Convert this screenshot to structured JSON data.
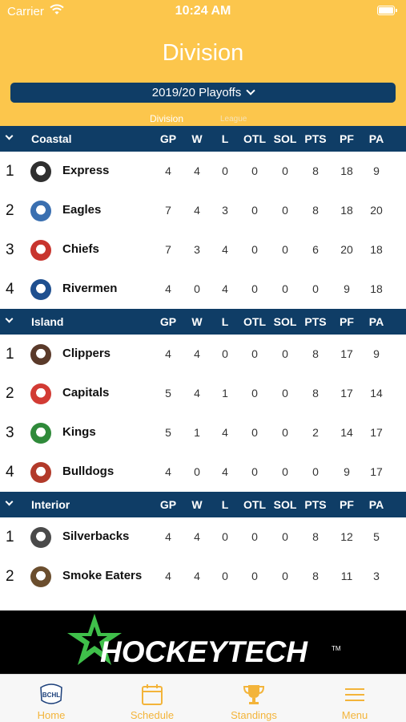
{
  "status": {
    "carrier": "Carrier",
    "time": "10:24 AM"
  },
  "header": {
    "title": "Division",
    "season": "2019/20 Playoffs",
    "tabs": {
      "division": "Division",
      "league": "League"
    }
  },
  "columns": [
    "GP",
    "W",
    "L",
    "OTL",
    "SOL",
    "PTS",
    "PF",
    "PA"
  ],
  "groups": [
    {
      "name": "Coastal",
      "teams": [
        {
          "rank": "1",
          "name": "Express",
          "stats": [
            "4",
            "4",
            "0",
            "0",
            "0",
            "8",
            "18",
            "9"
          ]
        },
        {
          "rank": "2",
          "name": "Eagles",
          "stats": [
            "7",
            "4",
            "3",
            "0",
            "0",
            "8",
            "18",
            "20"
          ]
        },
        {
          "rank": "3",
          "name": "Chiefs",
          "stats": [
            "7",
            "3",
            "4",
            "0",
            "0",
            "6",
            "20",
            "18"
          ]
        },
        {
          "rank": "4",
          "name": "Rivermen",
          "stats": [
            "4",
            "0",
            "4",
            "0",
            "0",
            "0",
            "9",
            "18"
          ]
        }
      ]
    },
    {
      "name": "Island",
      "teams": [
        {
          "rank": "1",
          "name": "Clippers",
          "stats": [
            "4",
            "4",
            "0",
            "0",
            "0",
            "8",
            "17",
            "9"
          ]
        },
        {
          "rank": "2",
          "name": "Capitals",
          "stats": [
            "5",
            "4",
            "1",
            "0",
            "0",
            "8",
            "17",
            "14"
          ]
        },
        {
          "rank": "3",
          "name": "Kings",
          "stats": [
            "5",
            "1",
            "4",
            "0",
            "0",
            "2",
            "14",
            "17"
          ]
        },
        {
          "rank": "4",
          "name": "Bulldogs",
          "stats": [
            "4",
            "0",
            "4",
            "0",
            "0",
            "0",
            "9",
            "17"
          ]
        }
      ]
    },
    {
      "name": "Interior",
      "teams": [
        {
          "rank": "1",
          "name": "Silverbacks",
          "stats": [
            "4",
            "4",
            "0",
            "0",
            "0",
            "8",
            "12",
            "5"
          ]
        },
        {
          "rank": "2",
          "name": "Smoke Eaters",
          "stats": [
            "4",
            "4",
            "0",
            "0",
            "0",
            "8",
            "11",
            "3"
          ]
        }
      ]
    }
  ],
  "banner": {
    "text": "HOCKEYTECH",
    "tm": "TM"
  },
  "tabbar": {
    "home": "Home",
    "schedule": "Schedule",
    "standings": "Standings",
    "menu": "Menu",
    "home_logo_text": "BCHL"
  },
  "colors": {
    "accent": "#fcc64c",
    "navy": "#0f3d66",
    "tab_active": "#f3b43a",
    "banner_green": "#3fbf4a"
  },
  "icons": [
    "wifi-icon",
    "battery-icon",
    "chevron-down-icon",
    "schedule-calendar-icon",
    "standings-trophy-icon",
    "menu-hamburger-icon"
  ]
}
